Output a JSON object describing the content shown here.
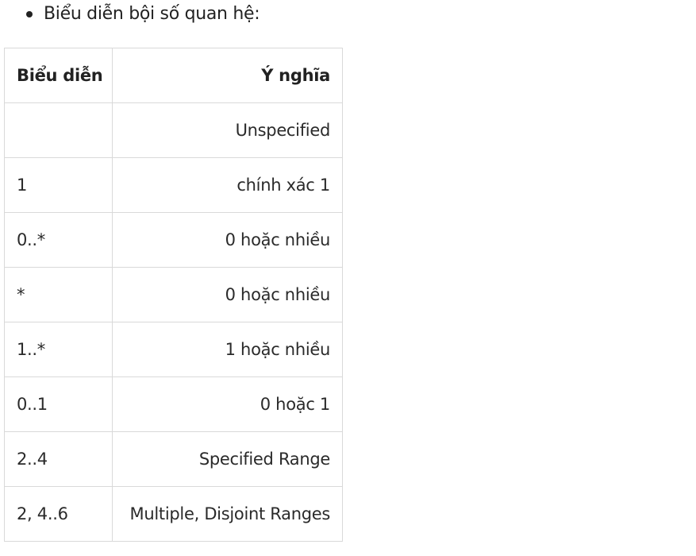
{
  "intro": {
    "bullet_text": "Biểu diễn bội số quan hệ:"
  },
  "table": {
    "headers": [
      "Biểu diễn",
      "Ý nghĩa"
    ],
    "rows": [
      {
        "notation": "",
        "meaning": "Unspecified"
      },
      {
        "notation": "1",
        "meaning": "chính xác 1"
      },
      {
        "notation": "0..*",
        "meaning": "0 hoặc nhiều"
      },
      {
        "notation": "*",
        "meaning": "0 hoặc nhiều"
      },
      {
        "notation": "1..*",
        "meaning": "1 hoặc nhiều"
      },
      {
        "notation": "0..1",
        "meaning": "0 hoặc 1"
      },
      {
        "notation": "2..4",
        "meaning": "Specified Range"
      },
      {
        "notation": "2, 4..6",
        "meaning": "Multiple, Disjoint Ranges"
      }
    ]
  }
}
